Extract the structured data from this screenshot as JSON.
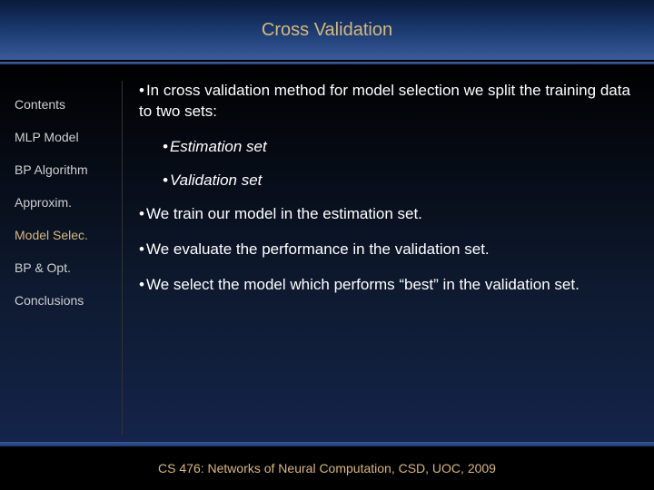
{
  "header": {
    "title": "Cross Validation"
  },
  "sidebar": {
    "items": [
      {
        "label": "Contents"
      },
      {
        "label": "MLP Model"
      },
      {
        "label": "BP Algorithm"
      },
      {
        "label": "Approxim."
      },
      {
        "label": "Model Selec."
      },
      {
        "label": "BP & Opt."
      },
      {
        "label": "Conclusions"
      }
    ]
  },
  "main": {
    "b1": "In cross validation method for model selection we split the training data to two sets:",
    "s1": "Estimation set",
    "s2": "Validation set",
    "b2": "We train our model in the estimation set.",
    "b3": "We evaluate the performance in the validation set.",
    "b4": "We select the model which performs “best” in the validation set."
  },
  "footer": {
    "text": "CS 476: Networks of Neural Computation, CSD, UOC, 2009"
  }
}
